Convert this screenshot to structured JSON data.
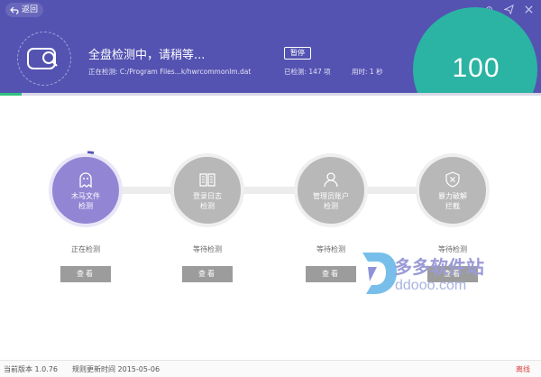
{
  "header": {
    "back_label": "返回",
    "scan_title": "全盘检测中，请稍等...",
    "pause_label": "暂停",
    "scanning_label": "正在检测:",
    "scanning_path": "C:/Program Files...k/hwrcommonlm.dat",
    "checked_label": "已检测: 147 项",
    "elapsed_label": "用时: 1 秒",
    "score": "100",
    "progress_fraction": 0.04,
    "window_icons": [
      "settings-icon",
      "send-icon",
      "close-icon"
    ]
  },
  "steps": [
    {
      "line1": "木马文件",
      "line2": "检测",
      "status": "正在检测",
      "button": "查看",
      "icon": "ghost-icon",
      "active": true
    },
    {
      "line1": "登录日志",
      "line2": "检测",
      "status": "等待检测",
      "button": "查看",
      "icon": "book-icon",
      "active": false
    },
    {
      "line1": "管理员账户",
      "line2": "检测",
      "status": "等待检测",
      "button": "查看",
      "icon": "user-icon",
      "active": false
    },
    {
      "line1": "暴力破解",
      "line2": "拦截",
      "status": "等待检测",
      "button": "查看",
      "icon": "shield-x-icon",
      "active": false
    }
  ],
  "watermark": {
    "name": "多多软件站",
    "url": "ddooo.com"
  },
  "footer": {
    "version": "当前版本 1.0.76",
    "update": "规则更新时间  2015-05-06",
    "status": "离线"
  },
  "colors": {
    "header_bg": "#5453b2",
    "score_bg": "#2bb4a3",
    "active_step": "#9286d4",
    "idle_step": "#b8b8b8",
    "progress": "#2ec27e"
  }
}
